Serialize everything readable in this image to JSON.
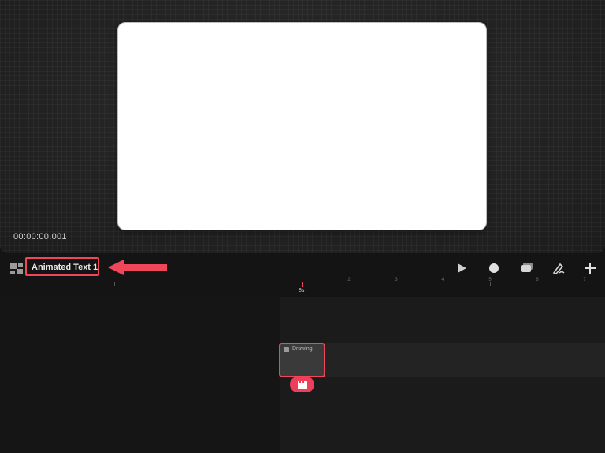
{
  "preview": {
    "timecode": "00:00:00.001"
  },
  "toolbar": {
    "project_title": "Animated Text 1",
    "icons": [
      "panels-icon",
      "play-icon",
      "record-icon",
      "layers-icon",
      "draw-icon",
      "add-icon"
    ]
  },
  "ruler": {
    "labels": [
      "1",
      "2",
      "3",
      "4",
      "5",
      "6",
      "7"
    ],
    "playhead_label": "8s"
  },
  "track": {
    "clip_label": "Drawing",
    "clip_badge_icon": "clapperboard-icon"
  },
  "colors": {
    "accent": "#f0465a",
    "background": "#141414",
    "canvas": "#ffffff"
  }
}
